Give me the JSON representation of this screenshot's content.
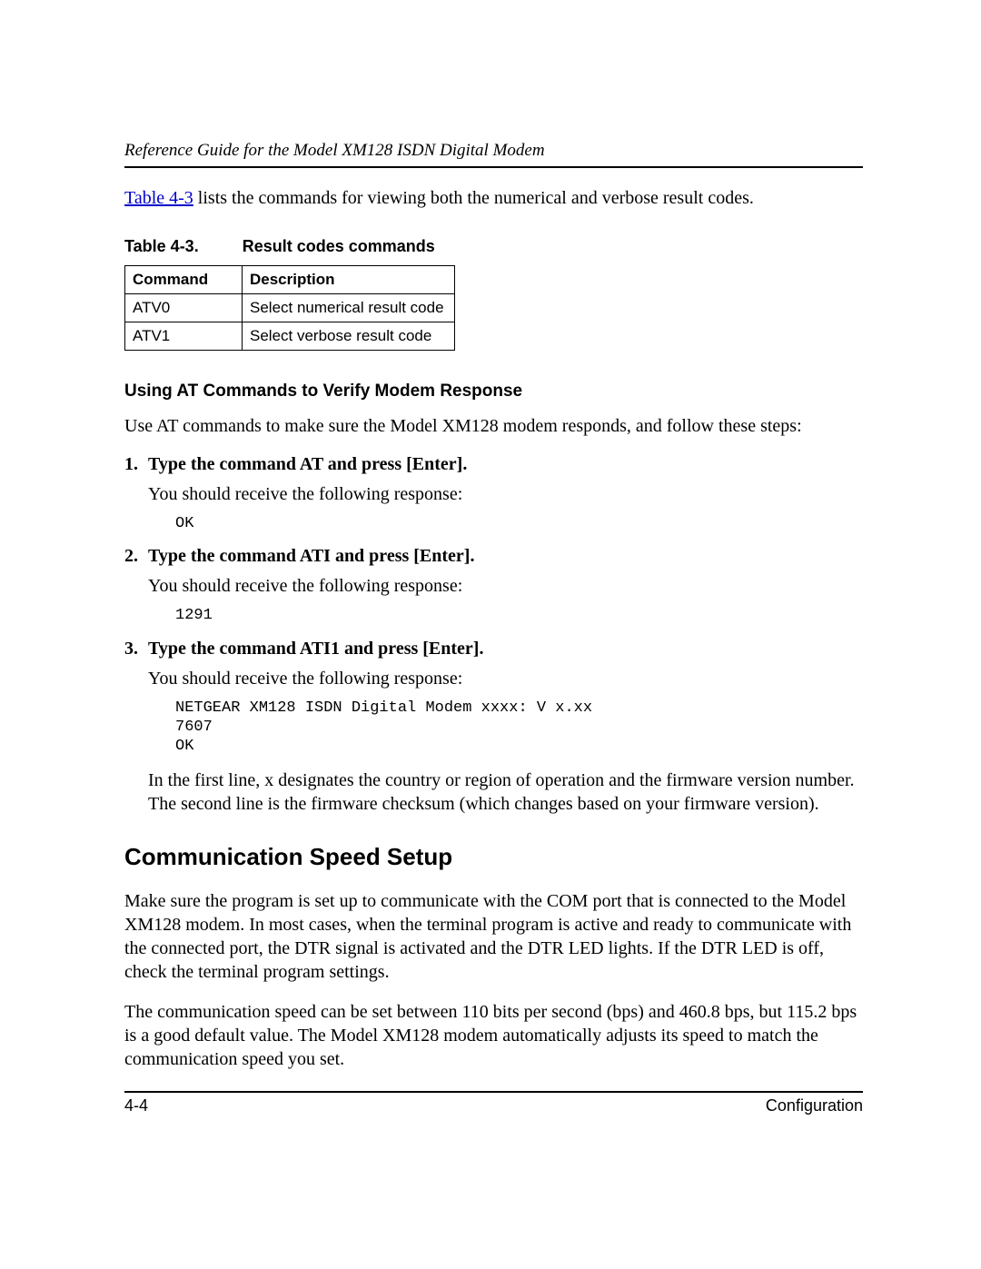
{
  "header": {
    "running_title": "Reference Guide for the Model XM128 ISDN Digital Modem"
  },
  "intro": {
    "link_text": "Table 4-3",
    "after_link": " lists the commands for viewing both the numerical and verbose result codes."
  },
  "table": {
    "caption_label": "Table 4-3.",
    "caption_title": "Result codes commands",
    "head_cmd": "Command",
    "head_desc": "Description",
    "rows": [
      {
        "cmd": "ATV0",
        "desc": "Select numerical result code"
      },
      {
        "cmd": "ATV1",
        "desc": "Select verbose result code"
      }
    ]
  },
  "verify": {
    "heading": "Using AT Commands to Verify Modem Response",
    "lead": "Use AT commands to make sure the Model XM128 modem responds, and follow these steps:",
    "steps": [
      {
        "num": "1.",
        "title": "Type the command AT and press [Enter].",
        "body": "You should receive the following response:",
        "code": "OK"
      },
      {
        "num": "2.",
        "title": "Type the command ATI and press [Enter].",
        "body": "You should receive the following response:",
        "code": "1291"
      },
      {
        "num": "3.",
        "title": "Type the command ATI1 and press [Enter].",
        "body": "You should receive the following response:",
        "code": "NETGEAR XM128 ISDN Digital Modem xxxx: V x.xx\n7607\nOK"
      }
    ],
    "after": "In the first line, x designates the country or region of operation and the firmware version number. The second line is the firmware checksum (which changes based on your firmware version)."
  },
  "speed": {
    "heading": "Communication Speed Setup",
    "p1": "Make sure the program is set up to communicate with the COM port that is connected to the Model XM128 modem. In most cases, when the terminal program is active and ready to communicate with the connected port, the DTR signal is activated and the DTR LED lights. If the DTR LED is off, check the terminal program settings.",
    "p2": "The communication speed can be set between 110 bits per second (bps) and 460.8 bps, but 115.2 bps is a good default value. The Model XM128 modem automatically adjusts its speed to match the communication speed you set."
  },
  "footer": {
    "left": "4-4",
    "right": "Configuration"
  }
}
